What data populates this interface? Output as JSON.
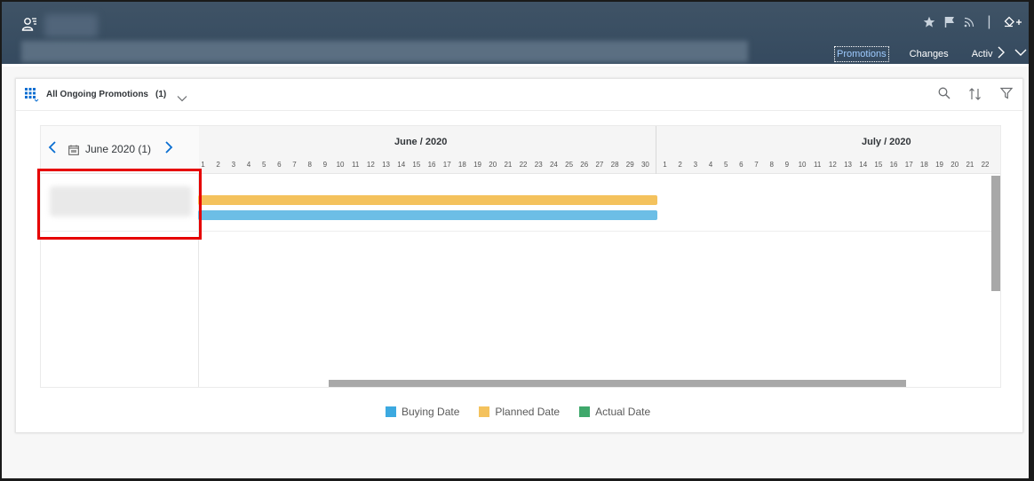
{
  "header": {
    "tabs": [
      {
        "label": "Promotions",
        "active": true
      },
      {
        "label": "Changes",
        "active": false
      },
      {
        "label": "Activ",
        "active": false
      }
    ]
  },
  "card": {
    "title": "All Ongoing Promotions",
    "count": "(1)"
  },
  "gantt": {
    "period_label": "June 2020 (1)",
    "months": [
      "June / 2020",
      "July / 2020"
    ],
    "june_days": [
      "1",
      "2",
      "3",
      "4",
      "5",
      "6",
      "7",
      "8",
      "9",
      "10",
      "11",
      "12",
      "13",
      "14",
      "15",
      "16",
      "17",
      "18",
      "19",
      "20",
      "21",
      "22",
      "23",
      "24",
      "25",
      "26",
      "27",
      "28",
      "29",
      "30"
    ],
    "july_days": [
      "1",
      "2",
      "3",
      "4",
      "5",
      "6",
      "7",
      "8",
      "9",
      "10",
      "11",
      "12",
      "13",
      "14",
      "15",
      "16",
      "17",
      "18",
      "19",
      "20",
      "21",
      "22"
    ],
    "bars": [
      {
        "type": "Planned Date",
        "start": "2020-06-01",
        "end": "2020-06-30",
        "color": "#f4c25d"
      },
      {
        "type": "Buying Date",
        "start": "2020-06-01",
        "end": "2020-06-30",
        "color": "#6cbee6"
      }
    ]
  },
  "legend": [
    {
      "label": "Buying Date",
      "color": "#3ca9e0"
    },
    {
      "label": "Planned Date",
      "color": "#f4c25d"
    },
    {
      "label": "Actual Date",
      "color": "#3fa86b"
    }
  ],
  "colors": {
    "shell": "#354a5f",
    "accent": "#0a6ed1",
    "highlight": "#e60000"
  }
}
